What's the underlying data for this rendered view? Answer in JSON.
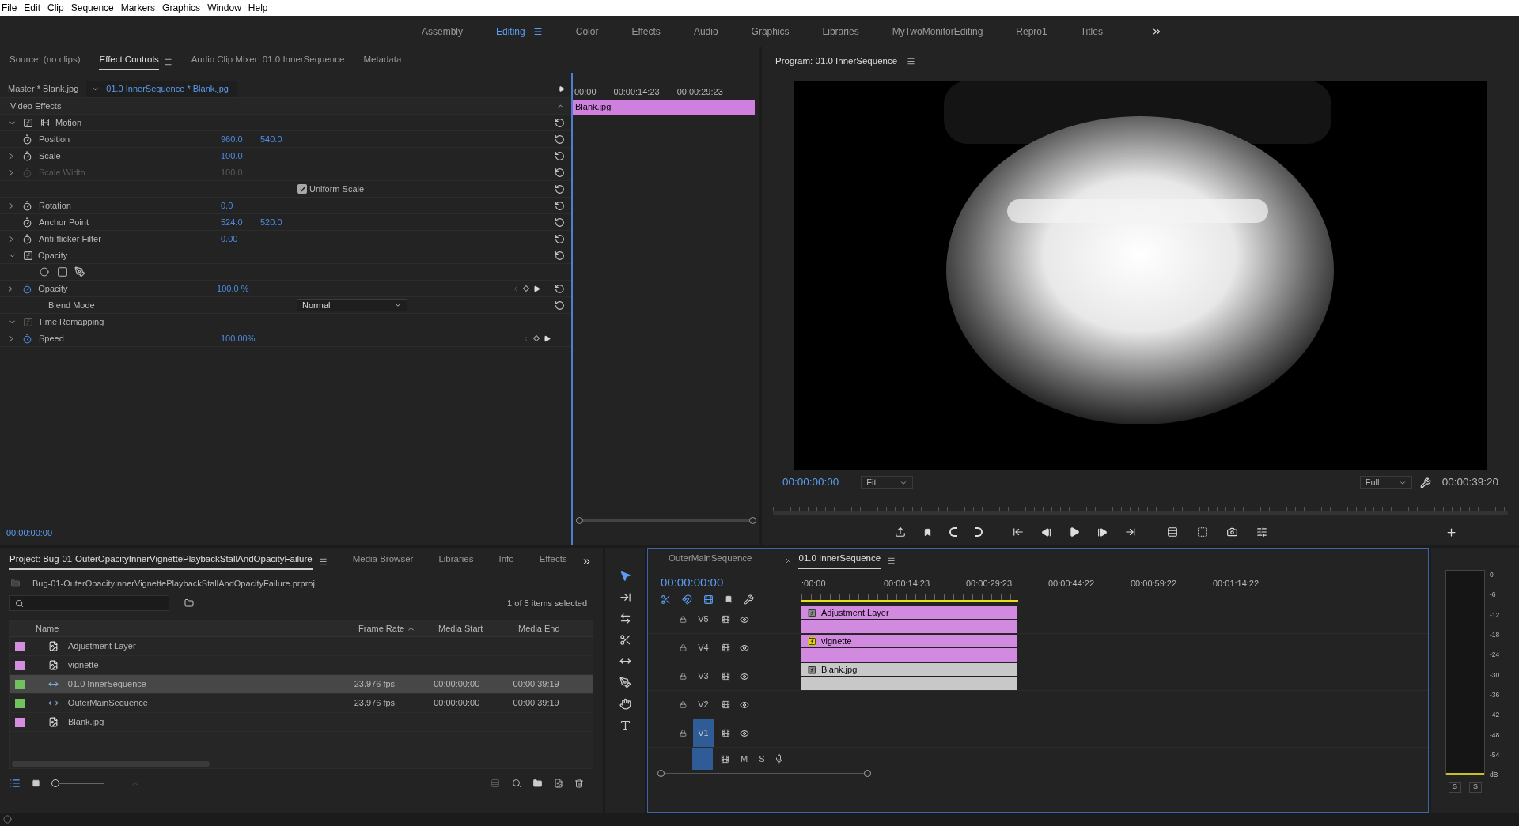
{
  "menu": [
    "File",
    "Edit",
    "Clip",
    "Sequence",
    "Markers",
    "Graphics",
    "Window",
    "Help"
  ],
  "workspaces": [
    {
      "label": "Assembly",
      "selected": false
    },
    {
      "label": "Editing",
      "selected": true
    },
    {
      "label": "Color",
      "selected": false
    },
    {
      "label": "Effects",
      "selected": false
    },
    {
      "label": "Audio",
      "selected": false
    },
    {
      "label": "Graphics",
      "selected": false
    },
    {
      "label": "Libraries",
      "selected": false
    },
    {
      "label": "MyTwoMonitorEditing",
      "selected": false
    },
    {
      "label": "Repro1",
      "selected": false
    },
    {
      "label": "Titles",
      "selected": false
    }
  ],
  "effect_controls": {
    "tabs": [
      {
        "label": "Source: (no clips)",
        "selected": false
      },
      {
        "label": "Effect Controls",
        "selected": true
      },
      {
        "label": "Audio Clip Mixer: 01.0 InnerSequence",
        "selected": false
      },
      {
        "label": "Metadata",
        "selected": false
      }
    ],
    "master": "Master * Blank.jpg",
    "clip": "01.0 InnerSequence * Blank.jpg",
    "ruler": [
      "00:00",
      "00:00:14:23",
      "00:00:29:23"
    ],
    "clip_bar": "Blank.jpg",
    "section": "Video Effects",
    "rows": [
      {
        "kind": "effect",
        "label": "Motion",
        "expanded": true,
        "disabled": false
      },
      {
        "kind": "param",
        "label": "Position",
        "values": [
          "960.0",
          "540.0"
        ],
        "expandable": false,
        "disabled": false,
        "animated": false
      },
      {
        "kind": "param",
        "label": "Scale",
        "values": [
          "100.0"
        ],
        "expandable": true,
        "disabled": false,
        "animated": false
      },
      {
        "kind": "param",
        "label": "Scale Width",
        "values": [
          "100.0"
        ],
        "expandable": true,
        "disabled": true,
        "animated": false
      },
      {
        "kind": "checkbox",
        "label": "Uniform Scale",
        "checked": true
      },
      {
        "kind": "param",
        "label": "Rotation",
        "values": [
          "0.0"
        ],
        "expandable": true,
        "disabled": false,
        "animated": false
      },
      {
        "kind": "param",
        "label": "Anchor Point",
        "values": [
          "524.0",
          "520.0"
        ],
        "expandable": false,
        "disabled": false,
        "animated": false
      },
      {
        "kind": "param",
        "label": "Anti-flicker Filter",
        "values": [
          "0.00"
        ],
        "expandable": true,
        "disabled": false,
        "animated": false
      },
      {
        "kind": "effect",
        "label": "Opacity",
        "expanded": true,
        "disabled": false
      },
      {
        "kind": "masks"
      },
      {
        "kind": "param",
        "label": "Opacity",
        "values": [
          "100.0 %"
        ],
        "expandable": true,
        "disabled": false,
        "animated": true
      },
      {
        "kind": "dropdown",
        "label": "Blend Mode",
        "value": "Normal"
      },
      {
        "kind": "effect",
        "label": "Time Remapping",
        "expanded": true,
        "disabled": true
      },
      {
        "kind": "param",
        "label": "Speed",
        "values": [
          "100.00%"
        ],
        "expandable": true,
        "disabled": false,
        "animated": true
      }
    ],
    "timecode": "00:00:00:00"
  },
  "program": {
    "title": "Program: 01.0 InnerSequence",
    "timecode": "00:00:00:00",
    "zoom": "Fit",
    "quality": "Full",
    "duration": "00:00:39:20"
  },
  "project": {
    "tabs": [
      {
        "label": "Project: Bug-01-OuterOpacityInnerVignettePlaybackStallAndOpacityFailure",
        "selected": true
      },
      {
        "label": "Media Browser",
        "selected": false
      },
      {
        "label": "Libraries",
        "selected": false
      },
      {
        "label": "Info",
        "selected": false
      },
      {
        "label": "Effects",
        "selected": false
      }
    ],
    "path": "Bug-01-OuterOpacityInnerVignettePlaybackStallAndOpacityFailure.prproj",
    "count": "1 of 5 items selected",
    "columns": [
      "Name",
      "Frame Rate",
      "Media Start",
      "Media End"
    ],
    "items": [
      {
        "name": "Adjustment Layer",
        "kind": "clip",
        "color": "#d68de0",
        "selected": false
      },
      {
        "name": "vignette",
        "kind": "clip",
        "color": "#d68de0",
        "selected": false
      },
      {
        "name": "01.0 InnerSequence",
        "kind": "sequence",
        "color": "#72c05e",
        "selected": true,
        "cells": [
          "23.976 fps",
          "00:00:00:00",
          "00:00:39:19"
        ]
      },
      {
        "name": "OuterMainSequence",
        "kind": "sequence",
        "color": "#72c05e",
        "selected": false,
        "cells": [
          "23.976 fps",
          "00:00:00:00",
          "00:00:39:19"
        ]
      },
      {
        "name": "Blank.jpg",
        "kind": "clip",
        "color": "#d68de0",
        "selected": false
      }
    ],
    "zoom_slider": {
      "level": 0
    }
  },
  "timeline": {
    "tabs": [
      {
        "label": "OuterMainSequence",
        "selected": false
      },
      {
        "label": "01.0 InnerSequence",
        "selected": true
      }
    ],
    "timecode": "00:00:00:00",
    "ruler": [
      ":00:00",
      "00:00:14:23",
      "00:00:29:23",
      "00:00:44:22",
      "00:00:59:22",
      "00:01:14:22"
    ],
    "tracks": [
      {
        "label": "V5",
        "targeted": false,
        "clip": {
          "name": "Adjustment Layer",
          "color": "#d18ae0",
          "fx": false
        }
      },
      {
        "label": "V4",
        "targeted": false,
        "clip": {
          "name": "vignette",
          "color": "#d18ae0",
          "fx": true
        }
      },
      {
        "label": "V3",
        "targeted": false,
        "clip": {
          "name": "Blank.jpg",
          "color": "#c8c8c8",
          "fx": false
        }
      },
      {
        "label": "V2",
        "targeted": false
      },
      {
        "label": "V1",
        "targeted": true
      }
    ],
    "audio_buttons": [
      "M",
      "S"
    ]
  },
  "meters": {
    "scale": [
      "0",
      "-6",
      "-12",
      "-18",
      "-24",
      "-30",
      "-36",
      "-42",
      "-48",
      "-54",
      "dB"
    ],
    "solo": [
      "S",
      "S"
    ]
  }
}
